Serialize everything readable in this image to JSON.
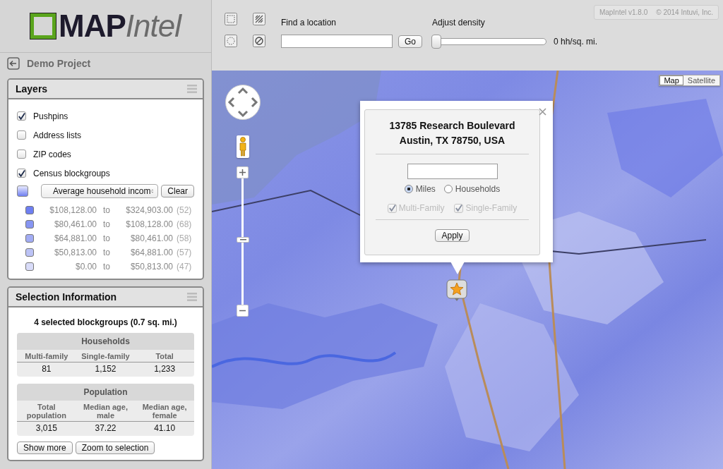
{
  "logo": {
    "primary": "MAP",
    "secondary": "Intel"
  },
  "project": {
    "title": "Demo Project"
  },
  "layers": {
    "title": "Layers",
    "items": [
      {
        "label": "Pushpins",
        "checked": true
      },
      {
        "label": "Address lists",
        "checked": false
      },
      {
        "label": "ZIP codes",
        "checked": false
      },
      {
        "label": "Census blockgroups",
        "checked": true
      }
    ],
    "metric": {
      "value": "Average household incom",
      "clear_button": "Clear"
    },
    "legend": [
      {
        "from": "$108,128.00",
        "sep": "to",
        "to": "$324,903.00",
        "count": "(52)",
        "color": "#6e7ff2"
      },
      {
        "from": "$80,461.00",
        "sep": "to",
        "to": "$108,128.00",
        "count": "(68)",
        "color": "#8795f2"
      },
      {
        "from": "$64,881.00",
        "sep": "to",
        "to": "$80,461.00",
        "count": "(58)",
        "color": "#a2acf4"
      },
      {
        "from": "$50,813.00",
        "sep": "to",
        "to": "$64,881.00",
        "count": "(57)",
        "color": "#bcc3f6"
      },
      {
        "from": "$0.00",
        "sep": "to",
        "to": "$50,813.00",
        "count": "(47)",
        "color": "#d9dcf9"
      }
    ]
  },
  "selection": {
    "title": "Selection Information",
    "summary": "4 selected blockgroups (0.7 sq. mi.)",
    "tables": [
      {
        "title": "Households",
        "columns": [
          "Multi-family",
          "Single-family",
          "Total"
        ],
        "values": [
          "81",
          "1,152",
          "1,233"
        ]
      },
      {
        "title": "Population",
        "columns": [
          "Total population",
          "Median age, male",
          "Median age, female"
        ],
        "values": [
          "3,015",
          "37.22",
          "41.10"
        ]
      }
    ],
    "buttons": [
      "Show more",
      "Zoom to selection"
    ]
  },
  "toolbar": {
    "find": {
      "label": "Find a location",
      "button": "Go"
    },
    "density": {
      "label": "Adjust density",
      "level": 0,
      "reading": "0 hh/sq. mi."
    },
    "version": "MapIntel v1.8.0",
    "copyright": "© 2014 Intuvi, Inc."
  },
  "map": {
    "type_tabs": [
      {
        "label": "Map",
        "selected": true
      },
      {
        "label": "Satellite",
        "selected": false
      }
    ],
    "zoom": {
      "level": 0.52
    },
    "popup": {
      "address_lines": [
        "13785 Research Boulevard",
        "Austin, TX 78750, USA"
      ],
      "units": [
        {
          "label": "Miles",
          "selected": true
        },
        {
          "label": "Households",
          "selected": false
        }
      ],
      "filters": [
        {
          "label": "Multi-Family",
          "checked": true,
          "disabled": true
        },
        {
          "label": "Single-Family",
          "checked": true,
          "disabled": true
        }
      ],
      "apply_button": "Apply"
    }
  }
}
